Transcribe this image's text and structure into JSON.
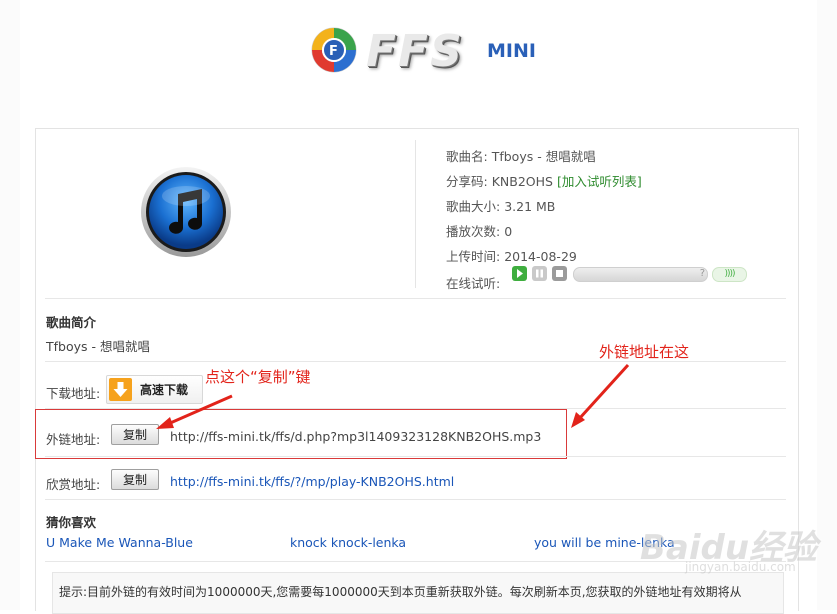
{
  "logo": {
    "text": "FFS",
    "mini": "MINI"
  },
  "song_info": {
    "name_label": "歌曲名:",
    "name_value": "Tfboys - 想唱就唱",
    "share_label": "分享码:",
    "share_value": "KNB2OHS",
    "add_link": "[加入试听列表]",
    "size_label": "歌曲大小:",
    "size_value": "3.21 MB",
    "plays_label": "播放次数:",
    "plays_value": "0",
    "upload_label": "上传时间:",
    "upload_value": "2014-08-29",
    "listen_label": "在线试听:",
    "player_help": "?",
    "player_volume": "))))"
  },
  "intro": {
    "title": "歌曲简介",
    "text": "Tfboys - 想唱就唱"
  },
  "download": {
    "label": "下载地址:",
    "button": "高速下载"
  },
  "external": {
    "label": "外链地址:",
    "copy_button": "复制",
    "url": "http://ffs-mini.tk/ffs/d.php?mp3l1409323128KNB2OHS.mp3"
  },
  "appreciate": {
    "label": "欣赏地址:",
    "copy_button": "复制",
    "url": "http://ffs-mini.tk/ffs/?/mp/play-KNB2OHS.html"
  },
  "like": {
    "title": "猜你喜欢",
    "items": [
      "U Make Me Wanna-Blue",
      "knock knock-lenka",
      "you will be mine-lenka"
    ]
  },
  "tip": "提示:目前外链的有效时间为1000000天,您需要每1000000天到本页重新获取外链。每次刷新本页,您获取的外链地址有效期将从",
  "annotations": {
    "copy_hint": "点这个“复制”键",
    "link_hint": "外链地址在这"
  },
  "watermark": {
    "brand": "Baidu经验",
    "sub": "jingyan.baidu.com"
  },
  "colors": {
    "annotation": "#e2231a",
    "link": "#1a56b8",
    "add_link": "#2e8b2e"
  }
}
